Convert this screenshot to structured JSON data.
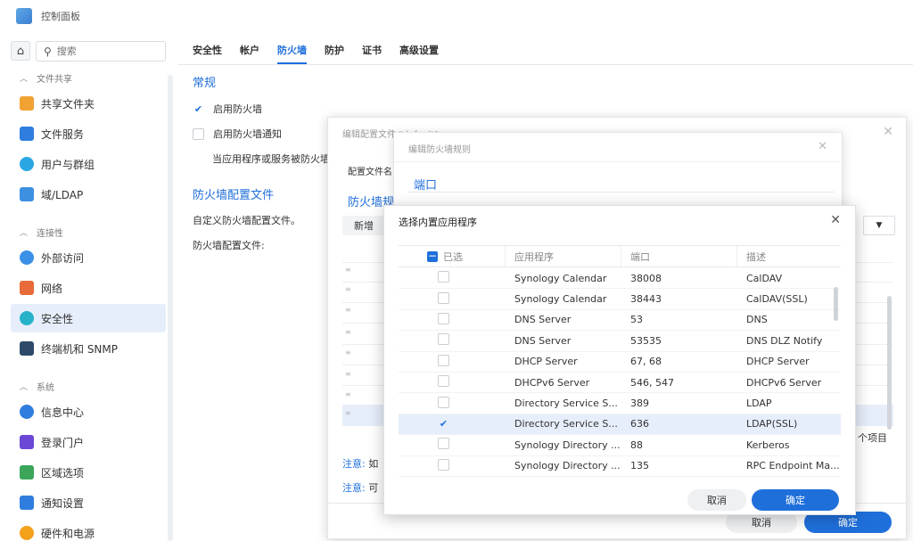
{
  "window": {
    "title": "控制面板"
  },
  "search": {
    "placeholder": "搜索"
  },
  "sidebar": {
    "groups": [
      "文件共享",
      "连接性",
      "系统"
    ],
    "items": [
      {
        "label": "共享文件夹",
        "icon": "folder-icon",
        "color": "#f0a232"
      },
      {
        "label": "文件服务",
        "icon": "file-services-icon",
        "color": "#2f7dde"
      },
      {
        "label": "用户与群组",
        "icon": "users-icon",
        "color": "#2aa7e3"
      },
      {
        "label": "域/LDAP",
        "icon": "domain-icon",
        "color": "#3d8fe0"
      },
      {
        "label": "外部访问",
        "icon": "external-access-icon",
        "color": "#3a90e6"
      },
      {
        "label": "网络",
        "icon": "network-icon",
        "color": "#e86b3a"
      },
      {
        "label": "安全性",
        "icon": "shield-icon",
        "color": "#26b2c9"
      },
      {
        "label": "终端机和 SNMP",
        "icon": "terminal-icon",
        "color": "#2d4a6a"
      },
      {
        "label": "信息中心",
        "icon": "info-icon",
        "color": "#2f7dde"
      },
      {
        "label": "登录门户",
        "icon": "login-portal-icon",
        "color": "#6b48d6"
      },
      {
        "label": "区域选项",
        "icon": "region-icon",
        "color": "#3ba65a"
      },
      {
        "label": "通知设置",
        "icon": "notification-icon",
        "color": "#2f7dde"
      },
      {
        "label": "硬件和电源",
        "icon": "power-icon",
        "color": "#f3a01b"
      }
    ]
  },
  "tabs": [
    "安全性",
    "帐户",
    "防火墙",
    "防护",
    "证书",
    "高级设置"
  ],
  "firewall": {
    "general_title": "常规",
    "enable_firewall": "启用防火墙",
    "enable_notify": "启用防火墙通知",
    "notify_desc": "当应用程序或服务被防火墙",
    "profile_title": "防火墙配置文件",
    "profile_desc": "自定义防火墙配置文件。",
    "profile_label": "防火墙配置文件:"
  },
  "edit_profile_dialog": {
    "title": "编辑配置文件 \"default\"",
    "profile_name_label": "配置文件名",
    "rules_title": "防火墙规",
    "new_button": "新增",
    "item_count": "个项目",
    "note_label": "注意:",
    "note_1": "如",
    "note_2": "可",
    "cancel": "取消",
    "ok": "确定"
  },
  "edit_rule_dialog": {
    "title": "编辑防火墙规则",
    "port_title": "端口"
  },
  "builtin_app_dialog": {
    "title": "选择内置应用程序",
    "headers": [
      "已选",
      "应用程序",
      "端口",
      "描述"
    ],
    "rows": [
      {
        "checked": false,
        "app": "Synology Calendar",
        "port": "38008",
        "desc": "CalDAV"
      },
      {
        "checked": false,
        "app": "Synology Calendar",
        "port": "38443",
        "desc": "CalDAV(SSL)"
      },
      {
        "checked": false,
        "app": "DNS Server",
        "port": "53",
        "desc": "DNS"
      },
      {
        "checked": false,
        "app": "DNS Server",
        "port": "53535",
        "desc": "DNS DLZ Notify"
      },
      {
        "checked": false,
        "app": "DHCP Server",
        "port": "67, 68",
        "desc": "DHCP Server"
      },
      {
        "checked": false,
        "app": "DHCPv6 Server",
        "port": "546, 547",
        "desc": "DHCPv6 Server"
      },
      {
        "checked": false,
        "app": "Directory Service S...",
        "port": "389",
        "desc": "LDAP"
      },
      {
        "checked": true,
        "app": "Directory Service S...",
        "port": "636",
        "desc": "LDAP(SSL)"
      },
      {
        "checked": false,
        "app": "Synology Directory ...",
        "port": "88",
        "desc": "Kerberos"
      },
      {
        "checked": false,
        "app": "Synology Directory ...",
        "port": "135",
        "desc": "RPC Endpoint Ma..."
      }
    ],
    "cancel": "取消",
    "ok": "确定"
  }
}
